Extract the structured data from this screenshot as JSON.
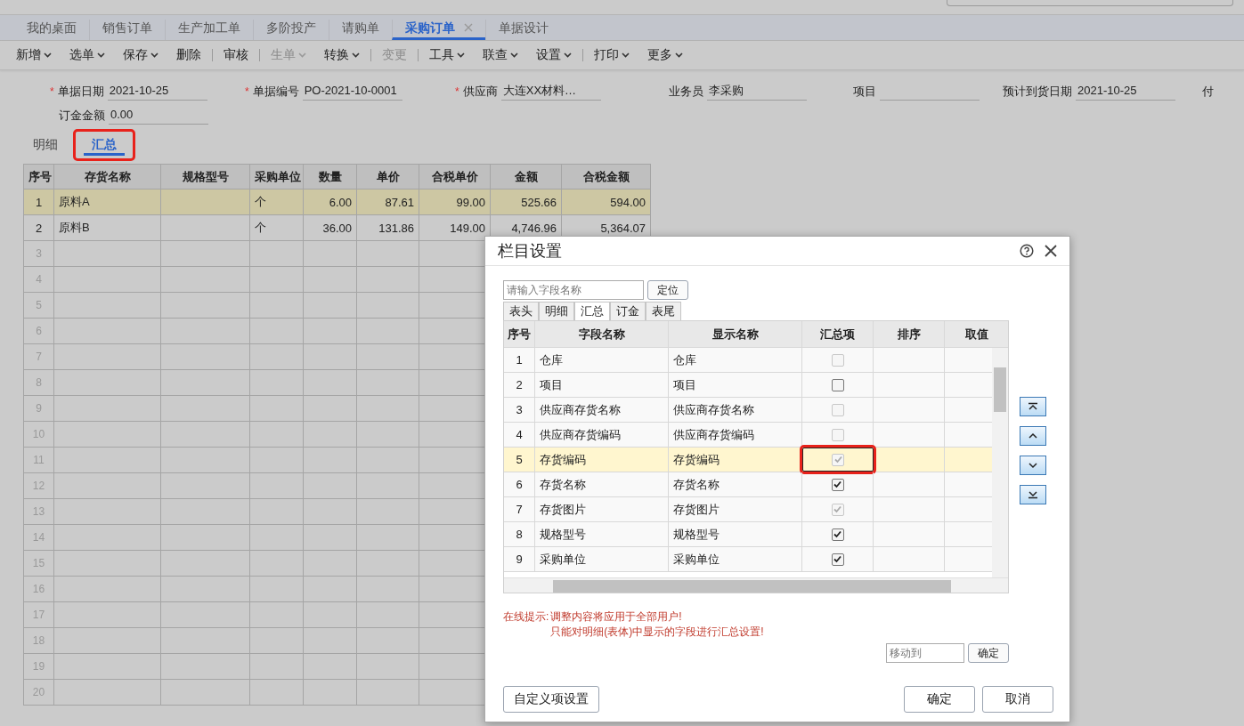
{
  "tabs": [
    {
      "label": "我的桌面",
      "selected": false,
      "closable": false
    },
    {
      "label": "销售订单",
      "selected": false,
      "closable": false
    },
    {
      "label": "生产加工单",
      "selected": false,
      "closable": false
    },
    {
      "label": "多阶投产",
      "selected": false,
      "closable": false
    },
    {
      "label": "请购单",
      "selected": false,
      "closable": false
    },
    {
      "label": "采购订单",
      "selected": true,
      "closable": true
    },
    {
      "label": "单据设计",
      "selected": false,
      "closable": false
    }
  ],
  "toolbar": [
    {
      "kind": "button",
      "label": "新增",
      "dropdown": true,
      "disabled": false
    },
    {
      "kind": "button",
      "label": "选单",
      "dropdown": true,
      "disabled": false
    },
    {
      "kind": "button",
      "label": "保存",
      "dropdown": true,
      "disabled": false
    },
    {
      "kind": "button",
      "label": "删除",
      "dropdown": false,
      "disabled": false
    },
    {
      "kind": "divider"
    },
    {
      "kind": "button",
      "label": "审核",
      "dropdown": false,
      "disabled": false
    },
    {
      "kind": "divider"
    },
    {
      "kind": "button",
      "label": "生单",
      "dropdown": true,
      "disabled": true
    },
    {
      "kind": "button",
      "label": "转换",
      "dropdown": true,
      "disabled": false
    },
    {
      "kind": "divider"
    },
    {
      "kind": "button",
      "label": "变更",
      "dropdown": false,
      "disabled": true
    },
    {
      "kind": "divider"
    },
    {
      "kind": "button",
      "label": "工具",
      "dropdown": true,
      "disabled": false
    },
    {
      "kind": "button",
      "label": "联查",
      "dropdown": true,
      "disabled": false
    },
    {
      "kind": "button",
      "label": "设置",
      "dropdown": true,
      "disabled": false
    },
    {
      "kind": "divider"
    },
    {
      "kind": "button",
      "label": "打印",
      "dropdown": true,
      "disabled": false
    },
    {
      "kind": "button",
      "label": "更多",
      "dropdown": true,
      "disabled": false
    }
  ],
  "form_rows": [
    [
      {
        "kind": "input",
        "label": "单据日期",
        "value": "2021-10-25",
        "required_mark": "*"
      },
      {
        "kind": "input",
        "label": "单据编号",
        "value": "PO-2021-10-0001",
        "required_mark": "*"
      },
      {
        "kind": "input",
        "label": "供应商",
        "value": "大连XX材料…",
        "required_mark": "*"
      },
      {
        "kind": "input",
        "label": "业务员",
        "value": "李采购"
      },
      {
        "kind": "input",
        "label": "项目"
      },
      {
        "kind": "input",
        "label": "预计到货日期",
        "value": "2021-10-25"
      },
      {
        "kind": "label",
        "label": "付"
      }
    ],
    [
      {
        "kind": "input",
        "label": "订金金额",
        "value": "0.00"
      }
    ]
  ],
  "sub_tabs": [
    {
      "label": "明细",
      "selected": false,
      "highlighted": false
    },
    {
      "label": "汇总",
      "selected": true,
      "highlighted": true
    }
  ],
  "table": {
    "columns": [
      "序号",
      "存货名称",
      "规格型号",
      "采购单位",
      "数量",
      "单价",
      "合税单价",
      "金额",
      "合税金额"
    ],
    "rows": [
      {
        "no": "1",
        "selected": true,
        "cells": [
          "原料A",
          "",
          "个",
          "6.00",
          "87.61",
          "99.00",
          "525.66",
          "594.00"
        ]
      },
      {
        "no": "2",
        "selected": false,
        "cells": [
          "原料B",
          "",
          "个",
          "36.00",
          "131.86",
          "149.00",
          "4,746.96",
          "5,364.07"
        ]
      },
      {
        "no": "3",
        "selected": false
      },
      {
        "no": "4",
        "selected": false
      },
      {
        "no": "5",
        "selected": false
      },
      {
        "no": "6",
        "selected": false
      },
      {
        "no": "7",
        "selected": false
      },
      {
        "no": "8",
        "selected": false
      },
      {
        "no": "9",
        "selected": false
      },
      {
        "no": "10",
        "selected": false
      },
      {
        "no": "11",
        "selected": false
      },
      {
        "no": "12",
        "selected": false
      },
      {
        "no": "13",
        "selected": false
      },
      {
        "no": "14",
        "selected": false
      },
      {
        "no": "15",
        "selected": false
      },
      {
        "no": "16",
        "selected": false
      },
      {
        "no": "17",
        "selected": false
      },
      {
        "no": "18",
        "selected": false
      },
      {
        "no": "19",
        "selected": false
      },
      {
        "no": "20",
        "selected": false
      }
    ]
  },
  "dialog": {
    "title": "栏目设置",
    "search": {
      "placeholder": "请输入字段名称",
      "button": "定位"
    },
    "tabs": [
      {
        "label": "表头",
        "selected": false
      },
      {
        "label": "明细",
        "selected": false
      },
      {
        "label": "汇总",
        "selected": true
      },
      {
        "label": "订金",
        "selected": false
      },
      {
        "label": "表尾",
        "selected": false
      }
    ],
    "columns": [
      "序号",
      "字段名称",
      "显示名称",
      "汇总项",
      "排序",
      "取值"
    ],
    "rows": [
      {
        "no": "1",
        "field": "仓库",
        "display": "仓库",
        "checked": false,
        "disabled": true,
        "selected": false,
        "highlighted": false
      },
      {
        "no": "2",
        "field": "项目",
        "display": "项目",
        "checked": false,
        "disabled": false,
        "selected": false,
        "highlighted": false
      },
      {
        "no": "3",
        "field": "供应商存货名称",
        "display": "供应商存货名称",
        "checked": false,
        "disabled": true,
        "selected": false,
        "highlighted": false
      },
      {
        "no": "4",
        "field": "供应商存货编码",
        "display": "供应商存货编码",
        "checked": false,
        "disabled": true,
        "selected": false,
        "highlighted": false
      },
      {
        "no": "5",
        "field": "存货编码",
        "display": "存货编码",
        "checked": true,
        "disabled": true,
        "selected": true,
        "highlighted": true
      },
      {
        "no": "6",
        "field": "存货名称",
        "display": "存货名称",
        "checked": true,
        "disabled": false,
        "selected": false,
        "highlighted": false
      },
      {
        "no": "7",
        "field": "存货图片",
        "display": "存货图片",
        "checked": true,
        "disabled": true,
        "selected": false,
        "highlighted": false
      },
      {
        "no": "8",
        "field": "规格型号",
        "display": "规格型号",
        "checked": true,
        "disabled": false,
        "selected": false,
        "highlighted": false
      },
      {
        "no": "9",
        "field": "采购单位",
        "display": "采购单位",
        "checked": true,
        "disabled": false,
        "selected": false,
        "highlighted": false
      }
    ],
    "hint_label": "在线提示:",
    "hints": [
      "调整内容将应用于全部用户!",
      "只能对明细(表体)中显示的字段进行汇总设置!"
    ],
    "move": {
      "placeholder": "移动到",
      "button": "确定"
    },
    "custom_button": "自定义项设置",
    "ok_button": "确定",
    "cancel_button": "取消"
  }
}
